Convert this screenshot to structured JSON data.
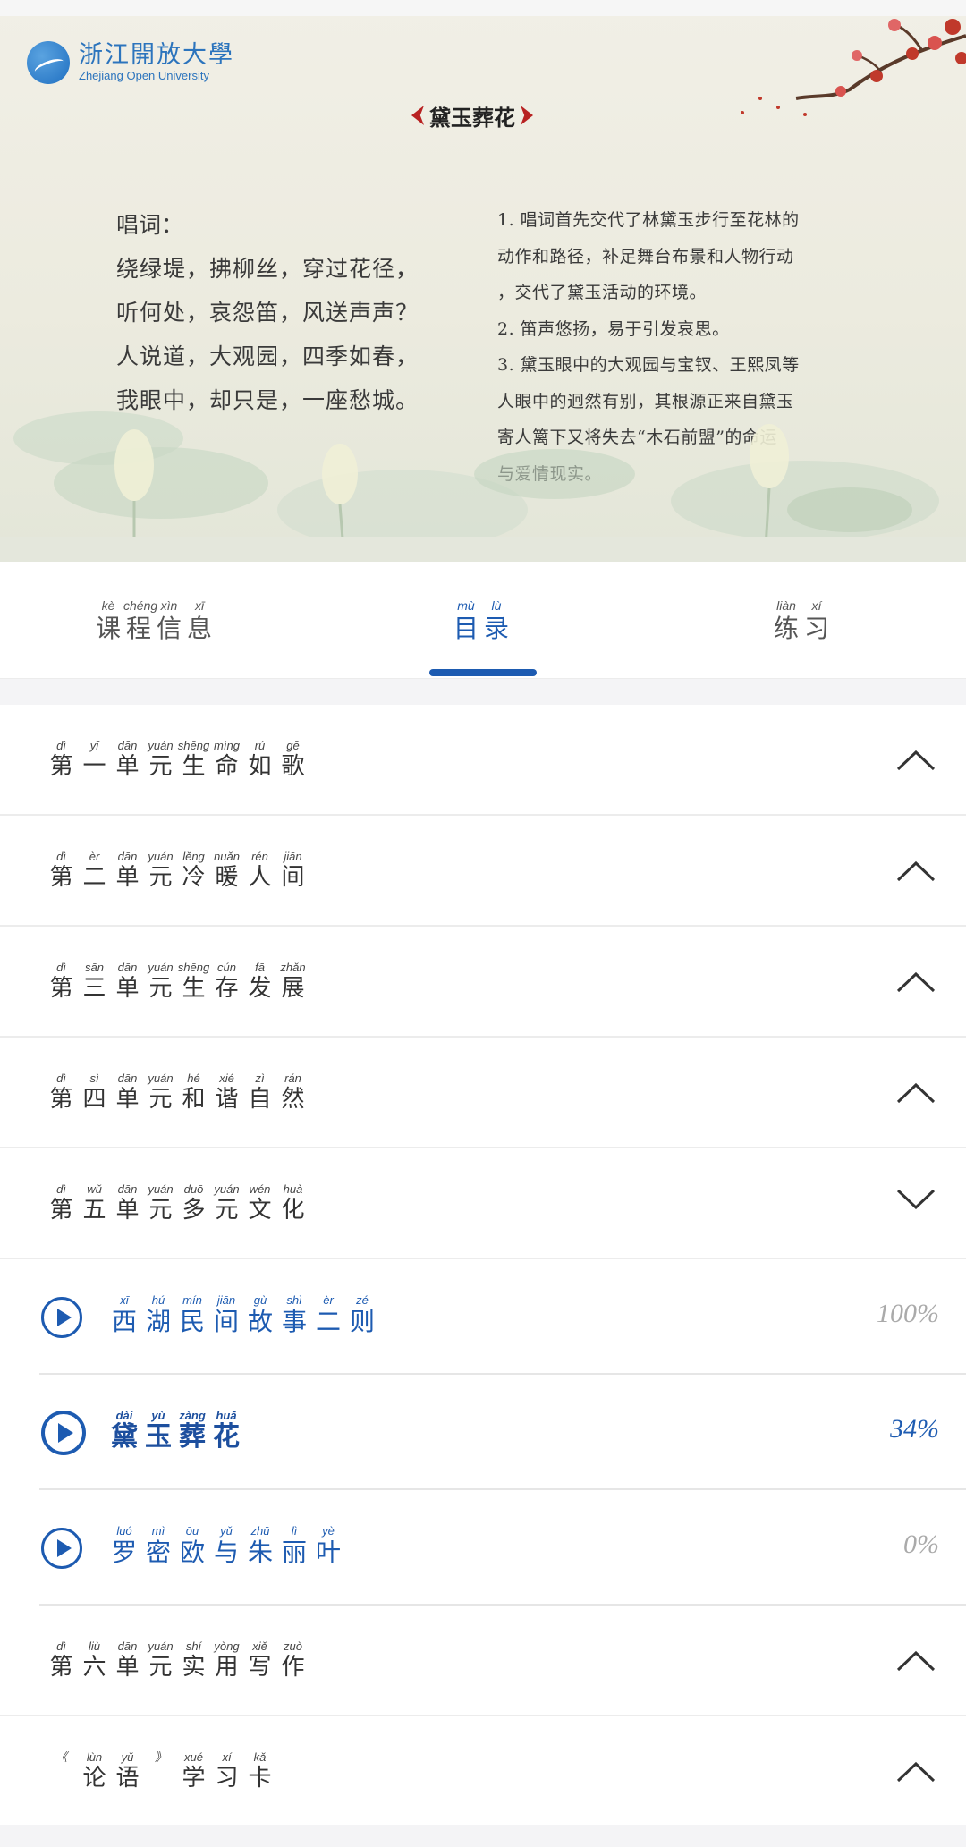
{
  "slide": {
    "logo_cn": "浙江開放大學",
    "logo_en": "Zhejiang Open University",
    "title": "黛玉葬花",
    "lyrics_label": "唱词：",
    "lyrics": [
      "绕绿堤，拂柳丝，穿过花径，",
      "听何处，哀怨笛，风送声声？",
      "人说道，大观园，四季如春，",
      "我眼中，却只是，一座愁城。"
    ],
    "notes": [
      "1. 唱词首先交代了林黛玉步行至花林的",
      "动作和路径，补足舞台布景和人物行动",
      "，交代了黛玉活动的环境。",
      "2. 笛声悠扬，易于引发哀思。",
      "3. 黛玉眼中的大观园与宝钗、王熙凤等",
      "人眼中的迥然有别，其根源正来自黛玉",
      "寄人篱下又将失去“木石前盟”的命运",
      "与爱情现实。"
    ]
  },
  "tabs": [
    {
      "chars": [
        [
          "kè",
          "课"
        ],
        [
          "chéng",
          "程"
        ],
        [
          "xìn",
          "信"
        ],
        [
          "xī",
          "息"
        ]
      ]
    },
    {
      "chars": [
        [
          "mù",
          "目"
        ],
        [
          "lù",
          "录"
        ]
      ]
    },
    {
      "chars": [
        [
          "liàn",
          "练"
        ],
        [
          "xí",
          "习"
        ]
      ]
    }
  ],
  "units": {
    "u1": [
      [
        "dì",
        "第"
      ],
      [
        "yī",
        "一"
      ],
      [
        "dān",
        "单"
      ],
      [
        "yuán",
        "元"
      ],
      [
        "shēng",
        "生"
      ],
      [
        "mìng",
        "命"
      ],
      [
        "rú",
        "如"
      ],
      [
        "gē",
        "歌"
      ]
    ],
    "u2": [
      [
        "dì",
        "第"
      ],
      [
        "èr",
        "二"
      ],
      [
        "dān",
        "单"
      ],
      [
        "yuán",
        "元"
      ],
      [
        "lěng",
        "冷"
      ],
      [
        "nuǎn",
        "暖"
      ],
      [
        "rén",
        "人"
      ],
      [
        "jiān",
        "间"
      ]
    ],
    "u3": [
      [
        "dì",
        "第"
      ],
      [
        "sān",
        "三"
      ],
      [
        "dān",
        "单"
      ],
      [
        "yuán",
        "元"
      ],
      [
        "shēng",
        "生"
      ],
      [
        "cún",
        "存"
      ],
      [
        "fā",
        "发"
      ],
      [
        "zhǎn",
        "展"
      ]
    ],
    "u4": [
      [
        "dì",
        "第"
      ],
      [
        "sì",
        "四"
      ],
      [
        "dān",
        "单"
      ],
      [
        "yuán",
        "元"
      ],
      [
        "hé",
        "和"
      ],
      [
        "xié",
        "谐"
      ],
      [
        "zì",
        "自"
      ],
      [
        "rán",
        "然"
      ]
    ],
    "u5": [
      [
        "dì",
        "第"
      ],
      [
        "wǔ",
        "五"
      ],
      [
        "dān",
        "单"
      ],
      [
        "yuán",
        "元"
      ],
      [
        "duō",
        "多"
      ],
      [
        "yuán",
        "元"
      ],
      [
        "wén",
        "文"
      ],
      [
        "huà",
        "化"
      ]
    ],
    "u6": [
      [
        "dì",
        "第"
      ],
      [
        "liù",
        "六"
      ],
      [
        "dān",
        "单"
      ],
      [
        "yuán",
        "元"
      ],
      [
        "shí",
        "实"
      ],
      [
        "yòng",
        "用"
      ],
      [
        "xiě",
        "写"
      ],
      [
        "zuò",
        "作"
      ]
    ],
    "u7": [
      [
        "《",
        ""
      ],
      [
        "lùn",
        "论"
      ],
      [
        "yǔ",
        "语"
      ],
      [
        "》",
        ""
      ],
      [
        "xué",
        "学"
      ],
      [
        "xí",
        "习"
      ],
      [
        "kǎ",
        "卡"
      ]
    ]
  },
  "lessons": {
    "l1": {
      "chars": [
        [
          "xī",
          "西"
        ],
        [
          "hú",
          "湖"
        ],
        [
          "mín",
          "民"
        ],
        [
          "jiān",
          "间"
        ],
        [
          "gù",
          "故"
        ],
        [
          "shì",
          "事"
        ],
        [
          "èr",
          "二"
        ],
        [
          "zé",
          "则"
        ]
      ],
      "progress": "100%"
    },
    "l2": {
      "chars": [
        [
          "dài",
          "黛"
        ],
        [
          "yù",
          "玉"
        ],
        [
          "zàng",
          "葬"
        ],
        [
          "huā",
          "花"
        ]
      ],
      "progress": "34%"
    },
    "l3": {
      "chars": [
        [
          "luó",
          "罗"
        ],
        [
          "mì",
          "密"
        ],
        [
          "ōu",
          "欧"
        ],
        [
          "yǔ",
          "与"
        ],
        [
          "zhū",
          "朱"
        ],
        [
          "lì",
          "丽"
        ],
        [
          "yè",
          "叶"
        ]
      ],
      "progress": "0%"
    }
  },
  "colors": {
    "accent": "#1d5bb1",
    "title_diamond": "#b82222",
    "muted_pct": "#aaaaaa"
  }
}
